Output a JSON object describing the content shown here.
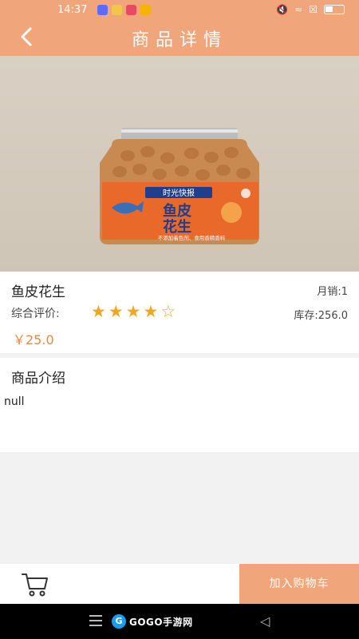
{
  "status_bar": {
    "time": "14:37",
    "app_colors": [
      "#5c6cff",
      "#f3c64b",
      "#e84a5f",
      "#f5b400"
    ]
  },
  "header": {
    "back_icon": "chevron-left-icon",
    "title": "商品详情",
    "background": "#f0a57a"
  },
  "product": {
    "image_label_brand": "时光快报",
    "image_label_name_line1": "鱼皮",
    "image_label_name_line2": "花生",
    "image_label_slogan": "不添加着色剂、食用香精香料",
    "name": "鱼皮花生",
    "monthly_sales": "月销:1",
    "rating_label": "综合评价:",
    "rating": 4,
    "rating_max": 5,
    "stock": "库存:256.0",
    "price": "￥25.0",
    "price_color": "#e8893f"
  },
  "intro": {
    "title": "商品介绍",
    "body": "null"
  },
  "action_bar": {
    "cart_icon": "cart-icon",
    "add_to_cart_label": "加入购物车"
  },
  "system_nav": {
    "logo_text": "GOGO手游网"
  }
}
